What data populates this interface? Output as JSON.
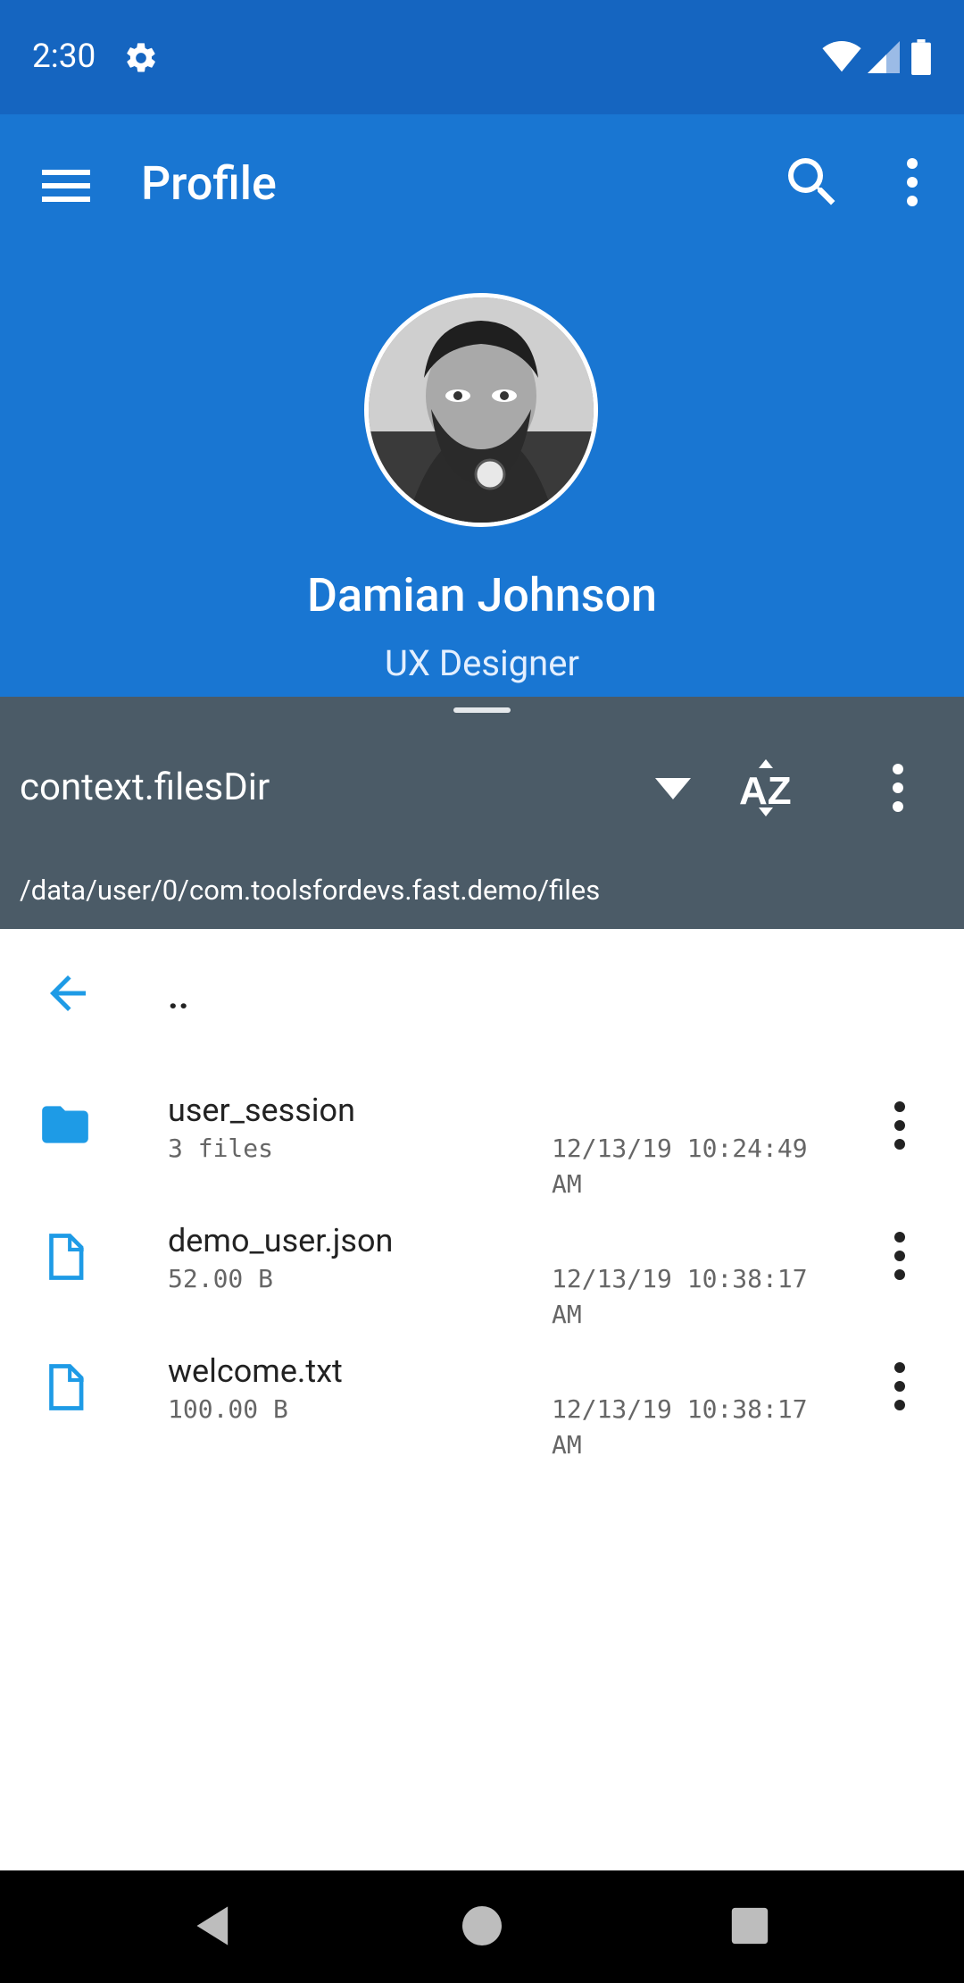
{
  "status_bar": {
    "time": "2:30"
  },
  "app_bar": {
    "title": "Profile"
  },
  "profile": {
    "name": "Damian Johnson",
    "role": "UX Designer"
  },
  "file_panel": {
    "directory": "context.filesDir",
    "path": "/data/user/0/com.toolsfordevs.fast.demo/files",
    "up_label": "..",
    "items": [
      {
        "name": "user_session",
        "meta": "3 files",
        "date": "12/13/19 10:24:49 AM",
        "icon": "folder-icon"
      },
      {
        "name": "demo_user.json",
        "meta": "52.00 B",
        "date": "12/13/19 10:38:17 AM",
        "icon": "file-icon"
      },
      {
        "name": "welcome.txt",
        "meta": "100.00 B",
        "date": "12/13/19 10:38:17 AM",
        "icon": "file-icon"
      }
    ]
  },
  "colors": {
    "status_bar": "#1565c0",
    "app_bar": "#1976d2",
    "panel_header": "#4b5b67",
    "accent": "#1e9be6"
  }
}
